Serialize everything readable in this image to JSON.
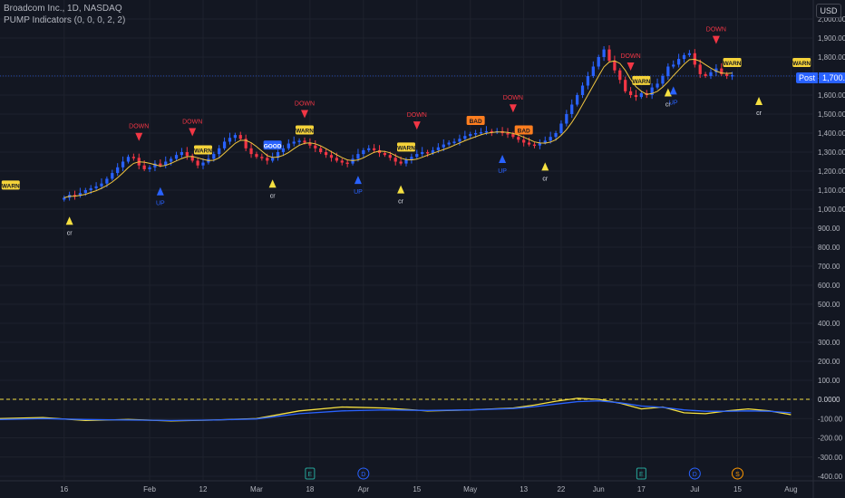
{
  "header": {
    "symbol_line": "Broadcom Inc., 1D, NASDAQ",
    "indicator_line": "PUMP Indicators (0, 0, 0, 2, 2)",
    "currency": "USD"
  },
  "last_price": {
    "label": "Post",
    "value": "1,700.25",
    "numeric": 1700.25
  },
  "colors": {
    "background": "#131722",
    "grid": "#1e222d",
    "up_candle": "#2962ff",
    "down_candle": "#f23645",
    "ma_line": "#f0c540",
    "osc_fast": "#f5e041",
    "osc_slow": "#2962ff",
    "zero_line": "#f5e041",
    "axis_text": "#b2b5be"
  },
  "chart_data": [
    {
      "type": "candlestick",
      "title": "Broadcom Inc., 1D, NASDAQ",
      "y_ticks": [
        "2,000.00",
        "1,900.00",
        "1,800.00",
        "1,700.00",
        "1,600.00",
        "1,500.00",
        "1,400.00",
        "1,300.00",
        "1,200.00",
        "1,100.00",
        "1,000.00",
        "900.00",
        "800.00",
        "700.00",
        "600.00",
        "500.00",
        "400.00",
        "300.00",
        "200.00",
        "100.00",
        "0.0000"
      ],
      "y_tick_values": [
        2000,
        1900,
        1800,
        1700,
        1600,
        1500,
        1400,
        1300,
        1200,
        1100,
        1000,
        900,
        800,
        700,
        600,
        500,
        400,
        300,
        200,
        100,
        0
      ],
      "ylim": [
        -50,
        2080
      ],
      "x_ticks": [
        "16",
        "Feb",
        "12",
        "Mar",
        "18",
        "Apr",
        "15",
        "May",
        "13",
        "22",
        "Jun",
        "17",
        "Jul",
        "15",
        "Aug"
      ],
      "x_tick_days": [
        0,
        16,
        26,
        36,
        46,
        56,
        66,
        76,
        86,
        93,
        100,
        108,
        118,
        126,
        136
      ],
      "xlim": [
        -12,
        140
      ],
      "days": [
        0,
        1,
        2,
        3,
        4,
        5,
        6,
        7,
        8,
        9,
        10,
        11,
        12,
        13,
        14,
        15,
        16,
        17,
        18,
        19,
        20,
        21,
        22,
        23,
        24,
        25,
        26,
        27,
        28,
        29,
        30,
        31,
        32,
        33,
        34,
        35,
        36,
        37,
        38,
        39,
        40,
        41,
        42,
        43,
        44,
        45,
        46,
        47,
        48,
        49,
        50,
        51,
        52,
        53,
        54,
        55,
        56,
        57,
        58,
        59,
        60,
        61,
        62,
        63,
        64,
        65,
        66,
        67,
        68,
        69,
        70,
        71,
        72,
        73,
        74,
        75,
        76,
        77,
        78,
        79,
        80,
        81,
        82,
        83,
        84,
        85,
        86,
        87,
        88,
        89,
        90,
        91,
        92,
        93,
        94,
        95,
        96,
        97,
        98,
        99,
        100,
        101,
        102,
        103,
        104,
        105,
        106,
        107,
        108,
        109,
        110,
        111,
        112,
        113,
        114,
        115,
        116,
        117,
        118,
        119,
        120,
        121,
        122,
        123,
        124,
        125
      ],
      "close": [
        1060,
        1075,
        1070,
        1085,
        1100,
        1110,
        1120,
        1135,
        1160,
        1190,
        1220,
        1250,
        1275,
        1270,
        1230,
        1210,
        1220,
        1240,
        1230,
        1250,
        1265,
        1285,
        1300,
        1280,
        1255,
        1230,
        1245,
        1265,
        1290,
        1320,
        1355,
        1375,
        1390,
        1370,
        1320,
        1290,
        1275,
        1270,
        1255,
        1270,
        1300,
        1320,
        1345,
        1355,
        1360,
        1350,
        1335,
        1320,
        1300,
        1285,
        1270,
        1255,
        1245,
        1240,
        1265,
        1290,
        1310,
        1320,
        1310,
        1295,
        1285,
        1270,
        1250,
        1240,
        1260,
        1275,
        1290,
        1300,
        1295,
        1310,
        1325,
        1340,
        1350,
        1355,
        1370,
        1385,
        1395,
        1400,
        1405,
        1410,
        1405,
        1410,
        1400,
        1395,
        1380,
        1365,
        1350,
        1340,
        1335,
        1350,
        1360,
        1380,
        1400,
        1450,
        1500,
        1550,
        1600,
        1650,
        1700,
        1750,
        1800,
        1840,
        1780,
        1730,
        1680,
        1620,
        1600,
        1590,
        1610,
        1600,
        1640,
        1660,
        1700,
        1750,
        1760,
        1790,
        1810,
        1820,
        1760,
        1710,
        1700,
        1720,
        1740,
        1710,
        1700,
        1705
      ],
      "ohlc_note": "open of each candle = previous close",
      "series": [
        {
          "name": "cr",
          "ma_period": 5
        }
      ],
      "signals": [
        {
          "day": -10,
          "text": "WARN",
          "kind": "warn-box"
        },
        {
          "day": 1,
          "text": "cr",
          "kind": "triangle-up"
        },
        {
          "day": 14,
          "text": "DOWN",
          "kind": "triangle-down"
        },
        {
          "day": 18,
          "text": "UP",
          "kind": "triangle-up-blue"
        },
        {
          "day": 24,
          "text": "DOWN",
          "kind": "triangle-down"
        },
        {
          "day": 26,
          "text": "WARN",
          "kind": "warn-box"
        },
        {
          "day": 39,
          "text": "GOOD",
          "kind": "good-box"
        },
        {
          "day": 39,
          "text": "cr",
          "kind": "triangle-up"
        },
        {
          "day": 45,
          "text": "DOWN",
          "kind": "triangle-down"
        },
        {
          "day": 45,
          "text": "WARN",
          "kind": "warn-box"
        },
        {
          "day": 55,
          "text": "UP",
          "kind": "triangle-up-blue"
        },
        {
          "day": 63,
          "text": "cr",
          "kind": "triangle-up"
        },
        {
          "day": 64,
          "text": "WARN",
          "kind": "warn-box"
        },
        {
          "day": 66,
          "text": "DOWN",
          "kind": "triangle-down"
        },
        {
          "day": 77,
          "text": "BAD",
          "kind": "bad-box"
        },
        {
          "day": 82,
          "text": "UP",
          "kind": "triangle-up-blue"
        },
        {
          "day": 84,
          "text": "DOWN",
          "kind": "triangle-down"
        },
        {
          "day": 86,
          "text": "BAD",
          "kind": "bad-box"
        },
        {
          "day": 90,
          "text": "cr",
          "kind": "triangle-up"
        },
        {
          "day": 106,
          "text": "DOWN",
          "kind": "triangle-down"
        },
        {
          "day": 108,
          "text": "WARN",
          "kind": "warn-box"
        },
        {
          "day": 113,
          "text": "cr",
          "kind": "triangle-up"
        },
        {
          "day": 114,
          "text": "UP",
          "kind": "triangle-up-blue"
        },
        {
          "day": 122,
          "text": "DOWN",
          "kind": "triangle-down"
        },
        {
          "day": 125,
          "text": "WARN",
          "kind": "warn-box"
        },
        {
          "day": 130,
          "text": "cr",
          "kind": "triangle-up"
        },
        {
          "day": 138,
          "text": "WARN",
          "kind": "warn-box"
        }
      ]
    },
    {
      "type": "line",
      "title": "PUMP Indicators (0, 0, 0, 2, 2)",
      "y_ticks": [
        "0.0000",
        "-100.00",
        "-200.00",
        "-300.00",
        "-400.00"
      ],
      "y_tick_values": [
        0,
        -100,
        -200,
        -300,
        -400
      ],
      "ylim": [
        -420,
        20
      ],
      "zero_line": 0,
      "series": [
        {
          "name": "fast",
          "x": [
            -12,
            -4,
            4,
            12,
            20,
            28,
            36,
            44,
            52,
            60,
            68,
            76,
            84,
            88,
            92,
            96,
            100,
            104,
            108,
            112,
            116,
            120,
            124,
            128,
            132,
            136
          ],
          "y": [
            -100,
            -95,
            -110,
            -105,
            -112,
            -108,
            -100,
            -60,
            -40,
            -45,
            -60,
            -55,
            -45,
            -30,
            -10,
            5,
            0,
            -20,
            -50,
            -40,
            -70,
            -75,
            -60,
            -50,
            -60,
            -80
          ]
        },
        {
          "name": "slow",
          "x": [
            -12,
            -4,
            4,
            12,
            20,
            28,
            36,
            44,
            52,
            60,
            68,
            76,
            84,
            88,
            92,
            96,
            100,
            104,
            108,
            112,
            116,
            120,
            124,
            128,
            132,
            136
          ],
          "y": [
            -105,
            -100,
            -105,
            -108,
            -110,
            -108,
            -102,
            -75,
            -60,
            -55,
            -58,
            -55,
            -48,
            -38,
            -25,
            -12,
            -8,
            -18,
            -35,
            -42,
            -55,
            -62,
            -62,
            -60,
            -62,
            -70
          ]
        }
      ],
      "event_markers": [
        {
          "day": 46,
          "text": "E"
        },
        {
          "day": 56,
          "text": "D"
        },
        {
          "day": 108,
          "text": "E"
        },
        {
          "day": 118,
          "text": "D"
        },
        {
          "day": 126,
          "text": "S"
        }
      ]
    }
  ]
}
